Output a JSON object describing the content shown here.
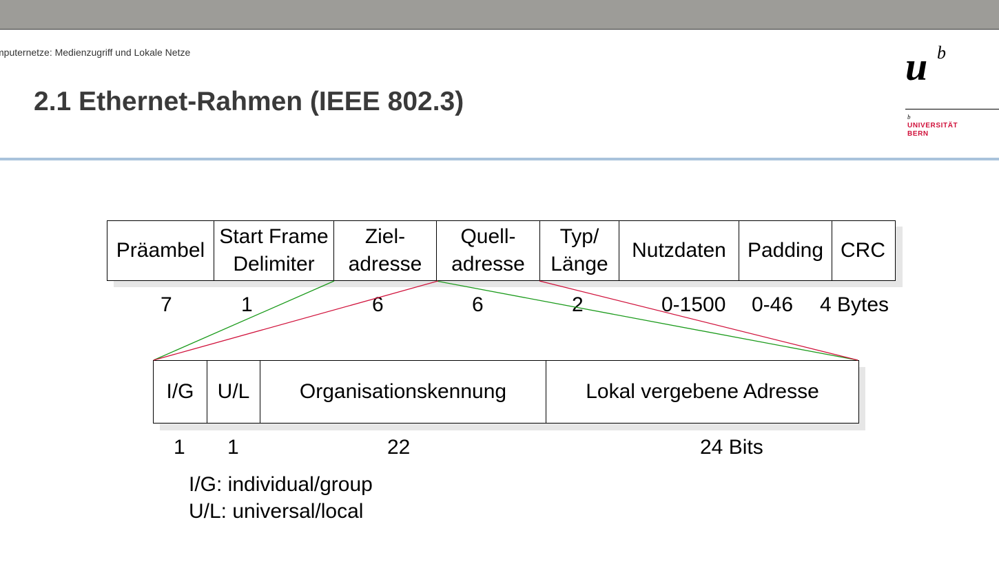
{
  "header": {
    "course": "mputernetze: Medienzugriff und Lokale Netze",
    "title": "2.1 Ethernet-Rahmen (IEEE 802.3)"
  },
  "logo": {
    "mark_u": "u",
    "mark_b": "b",
    "small_b": "b",
    "university": "UNIVERSITÄT",
    "city": "BERN"
  },
  "frame": {
    "fields": [
      {
        "line1": "Präambel",
        "line2": ""
      },
      {
        "line1": "Start Frame",
        "line2": "Delimiter"
      },
      {
        "line1": "Ziel-",
        "line2": "adresse"
      },
      {
        "line1": "Quell-",
        "line2": "adresse"
      },
      {
        "line1": "Typ/",
        "line2": "Länge"
      },
      {
        "line1": "Nutzdaten",
        "line2": ""
      },
      {
        "line1": "Padding",
        "line2": ""
      },
      {
        "line1": "CRC",
        "line2": ""
      }
    ],
    "sizes": [
      "7",
      "1",
      "6",
      "6",
      "2",
      "0-1500",
      "0-46",
      "4 Bytes"
    ]
  },
  "address": {
    "fields": [
      "I/G",
      "U/L",
      "Organisationskennung",
      "Lokal vergebene Adresse"
    ],
    "sizes": [
      "1",
      "1",
      "22",
      "24 Bits"
    ]
  },
  "legend": {
    "line1": "I/G: individual/group",
    "line2": "U/L: universal/local"
  },
  "colors": {
    "topbar": "#9d9c98",
    "divider": "#a9c3dc",
    "green_line": "#1a9a1a",
    "red_line": "#d0103a",
    "brand_red": "#d0103a"
  }
}
